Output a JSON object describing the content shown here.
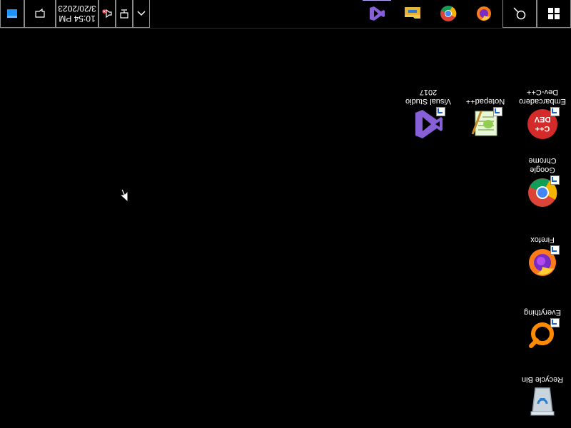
{
  "desktop": {
    "icons": [
      {
        "name": "recycle-bin",
        "label": "Recycle Bin"
      },
      {
        "name": "everything",
        "label": "Everything"
      },
      {
        "name": "firefox",
        "label": "Firefox"
      },
      {
        "name": "google-chrome",
        "label": "Google Chrome"
      },
      {
        "name": "dev-cpp",
        "label": "Embarcadero Dev-C++"
      },
      {
        "name": "notepad-plus-plus",
        "label": "Notepad++"
      },
      {
        "name": "visual-studio",
        "label": "Visual Studio 2017"
      }
    ]
  },
  "taskbar": {
    "start_icon": "windows-logo-icon",
    "search_icon": "search-icon",
    "pinned_apps": [
      "firefox-icon",
      "chrome-icon",
      "file-explorer-icon",
      "visual-studio-icon"
    ],
    "tray": {
      "overflow_icon": "chevron-up-icon",
      "network_icon": "network-icon",
      "volume_icon": "volume-muted-icon",
      "time": "10:54 PM",
      "date": "3/20/2023",
      "notification_icon": "notification-icon",
      "show_desktop_icon": "show-desktop-icon"
    }
  },
  "colors": {
    "background": "#000000",
    "taskbar_border": "#8a8a8a",
    "active_indicator": "#b9a3ff"
  }
}
